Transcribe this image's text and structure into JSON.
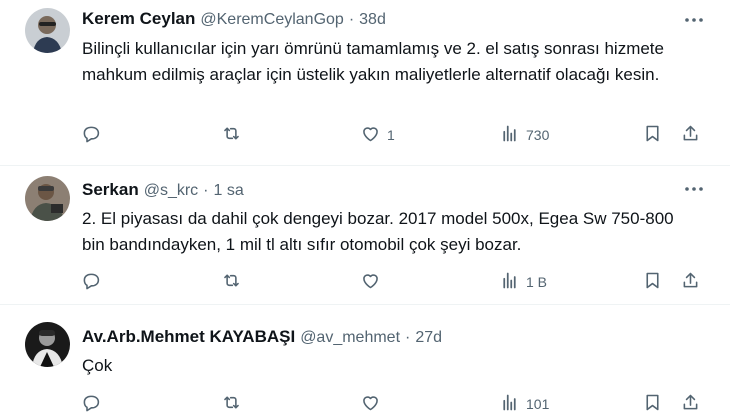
{
  "tweets": [
    {
      "name": "Kerem Ceylan",
      "handle": "@KeremCeylanGop",
      "separator": "·",
      "time": "38d",
      "text": "Bilinçli kullanıcılar için yarı ömrünü tamamlamış ve 2. el satış sonrası hizmete mahkum edilmiş araçlar için üstelik yakın maliyetlerle alternatif olacağı kesin.",
      "likes": "1",
      "views": "730"
    },
    {
      "name": "Serkan",
      "handle": "@s_krc",
      "separator": "·",
      "time": "1 sa",
      "text": "2. El piyasası da dahil çok dengeyi bozar. 2017 model 500x, Egea Sw 750-800 bin bandındayken, 1 mil tl altı sıfır otomobil çok şeyi bozar.",
      "likes": "",
      "views": "1 B"
    },
    {
      "name": "Av.Arb.Mehmet KAYABAŞI",
      "handle": "@av_mehmet",
      "separator": "·",
      "time": "27d",
      "text": "Çok",
      "likes": "",
      "views": "101"
    }
  ],
  "colors": {
    "text": "#0f1419",
    "secondary": "#536471",
    "divider": "#eff3f4"
  },
  "icons": [
    "reply-icon",
    "retweet-icon",
    "like-icon",
    "views-icon",
    "bookmark-icon",
    "share-icon",
    "more-icon"
  ]
}
